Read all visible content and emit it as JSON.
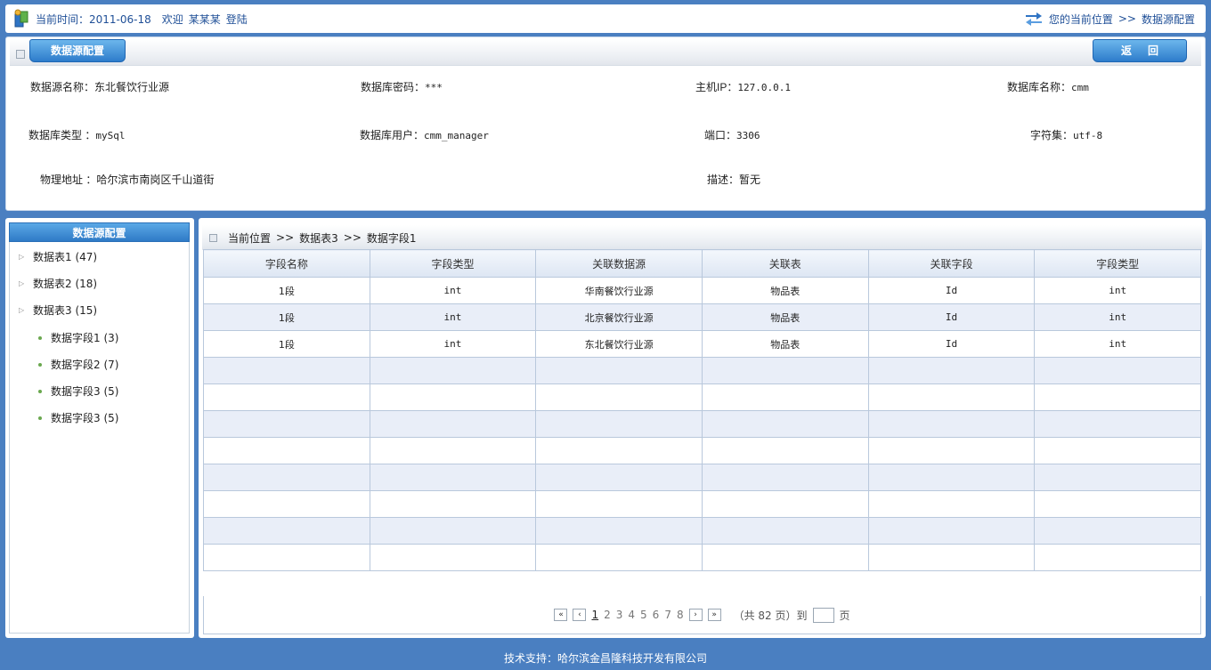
{
  "topbar": {
    "time_label": "当前时间：2011-06-18",
    "welcome": "欢迎",
    "user": "某某某",
    "login": "登陆",
    "location_label": "您的当前位置",
    "separator": ">>",
    "location_page": "数据源配置"
  },
  "config": {
    "title": "数据源配置",
    "back_label": "返回",
    "fields": [
      {
        "key": "数据源名称：",
        "value": "东北餐饮行业源"
      },
      {
        "key": "数据库密码：",
        "value": "***"
      },
      {
        "key": "主机IP：",
        "value": "127.0.0.1"
      },
      {
        "key": "数据库名称：",
        "value": "cmm"
      },
      {
        "key": "数据库类型 ：",
        "value": "mySql"
      },
      {
        "key": "数据库用户：",
        "value": "cmm_manager"
      },
      {
        "key": "端口：",
        "value": "3306"
      },
      {
        "key": "字符集：",
        "value": "utf-8"
      },
      {
        "key": "物理地址 ：",
        "value": "哈尔滨市南岗区千山道街"
      },
      {
        "key": "描述：",
        "value": "暂无"
      }
    ]
  },
  "sidebar": {
    "title": "数据源配置",
    "tables": [
      {
        "label": "数据表1",
        "count": "(47)"
      },
      {
        "label": "数据表2",
        "count": "(18)"
      },
      {
        "label": "数据表3",
        "count": "(15)"
      }
    ],
    "fields": [
      {
        "label": "数据字段1",
        "count": "(3)"
      },
      {
        "label": "数据字段2",
        "count": "(7)"
      },
      {
        "label": "数据字段3",
        "count": "(5)"
      },
      {
        "label": "数据字段3",
        "count": "(5)"
      }
    ]
  },
  "breadcrumb": {
    "label": "当前位置",
    "sep1": ">>",
    "level1": "数据表3",
    "sep2": ">>",
    "level2": "数据字段1"
  },
  "table": {
    "headers": [
      "字段名称",
      "字段类型",
      "关联数据源",
      "关联表",
      "关联字段",
      "字段类型"
    ],
    "rows": [
      [
        "1段",
        "int",
        "华南餐饮行业源",
        "物品表",
        "Id",
        "int"
      ],
      [
        "1段",
        "int",
        "北京餐饮行业源",
        "物品表",
        "Id",
        "int"
      ],
      [
        "1段",
        "int",
        "东北餐饮行业源",
        "物品表",
        "Id",
        "int"
      ]
    ]
  },
  "pager": {
    "first": "«",
    "prev": "‹",
    "pages": [
      "1",
      "2",
      "3",
      "4",
      "5",
      "6",
      "7",
      "8"
    ],
    "current": "1",
    "next": "›",
    "last": "»",
    "total_text": "（共 82 页）到",
    "page_suffix": "页"
  },
  "footer": {
    "text": "技术支持：哈尔滨金昌隆科技开发有限公司"
  }
}
